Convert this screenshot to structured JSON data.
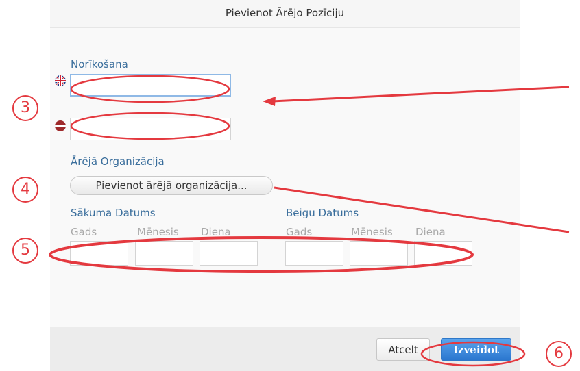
{
  "dialog": {
    "title": "Pievienot Ārējo Pozīciju",
    "position_section": {
      "label": "Norīkošana",
      "english_value": "",
      "latvian_value": ""
    },
    "organization_section": {
      "label": "Ārējā Organizācija",
      "button_label": "Pievienot ārējā organizācija..."
    },
    "start_date": {
      "label": "Sākuma Datums",
      "year_label": "Gads",
      "month_label": "Mēnesis",
      "day_label": "Diena"
    },
    "end_date": {
      "label": "Beigu Datums",
      "year_label": "Gads",
      "month_label": "Mēnesis",
      "day_label": "Diena"
    },
    "footer": {
      "cancel_label": "Atcelt",
      "create_label": "Izveidot"
    }
  },
  "annotations": {
    "steps": [
      "3",
      "4",
      "5",
      "6"
    ],
    "color": "#e4393f"
  },
  "colors": {
    "label_blue": "#3a6e9c",
    "primary_button": "#2b77cf"
  }
}
